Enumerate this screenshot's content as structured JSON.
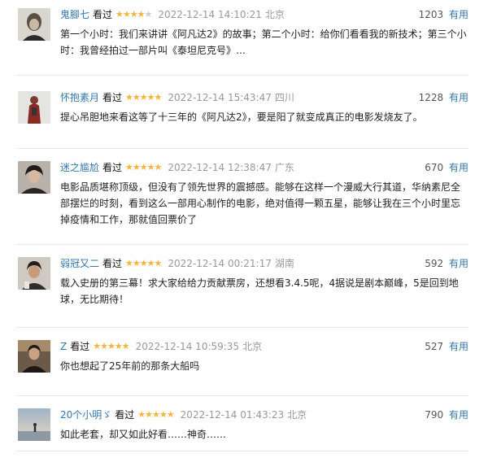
{
  "colors": {
    "link": "#3377aa",
    "star": "#f4b43f",
    "star_off": "#cccccc",
    "meta": "#999999",
    "divider": "#e8e8e8"
  },
  "labels": {
    "useful": "有用"
  },
  "reviews": [
    {
      "author": "鬼腳七",
      "status": "看过",
      "rating": 4,
      "time": "2022-12-14 14:10:21",
      "location": "北京",
      "votes": "1203",
      "content": "第一个小时：我们来讲讲《阿凡达2》的故事；第二个小时：给你们看看我的新技术；第三个小时：我曾经拍过一部片叫《泰坦尼克号》…",
      "avatar_icon": "avatar-photo-portrait"
    },
    {
      "author": "怀抱素月",
      "status": "看过",
      "rating": 5,
      "time": "2022-12-14 15:43:47",
      "location": "四川",
      "votes": "1228",
      "content": "提心吊胆地来看这等了十三年的《阿凡达2》，要是阳了就变成真正的电影发烧友了。",
      "avatar_icon": "avatar-photo-figure"
    },
    {
      "author": "迷之尴尬",
      "status": "看过",
      "rating": 5,
      "time": "2022-12-14 12:38:47",
      "location": "广东",
      "votes": "670",
      "content": "电影品质堪称顶级，但没有了领先世界的震撼感。能够在这样一个漫威大行其道，华纳素尼全部摆烂的时刻，看到这么一部用心制作的电影，绝对值得一颗五星，能够让我在三个小时里忘掉疫情和工作，那就值回票价了",
      "avatar_icon": "avatar-photo-person"
    },
    {
      "author": "弱冠又二",
      "status": "看过",
      "rating": 5,
      "time": "2022-12-14 00:21:17",
      "location": "湖南",
      "votes": "592",
      "content": "载入史册的第三幕！求大家给给力贡献票房，还想看3.4.5呢，4据说是剧本巅峰，5是回到地球，无比期待！",
      "avatar_icon": "avatar-photo-person"
    },
    {
      "author": "Z",
      "status": "看过",
      "rating": 5,
      "time": "2022-12-14 10:59:35",
      "location": "北京",
      "votes": "527",
      "content": "你也想起了25年前的那条大船吗",
      "avatar_icon": "avatar-photo-person"
    },
    {
      "author": "20个小明ゞ",
      "status": "看过",
      "rating": 5,
      "time": "2022-12-14 01:43:23",
      "location": "北京",
      "votes": "790",
      "content": "如此老套，却又如此好看……神奇……",
      "avatar_icon": "avatar-photo-landscape"
    }
  ]
}
